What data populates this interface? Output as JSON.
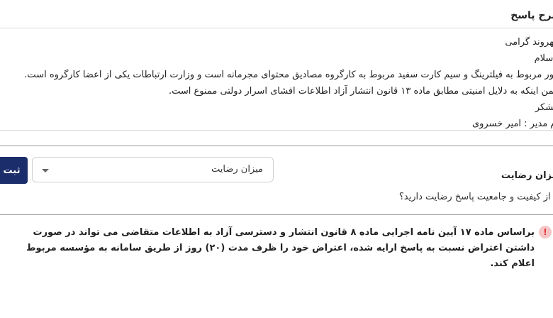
{
  "answer": {
    "header": "شرح پاسخ",
    "lines": [
      "شهروند گرامی",
      "با سلام",
      "امور مربوط به فیلترینگ و سیم کارت سفید مربوط به کارگروه مصادیق محتوای مجرمانه است و وزارت ارتباطات یکی از اعضا کارگروه است.",
      "ضمن اینکه به دلایل امنیتی مطابق ماده ۱۳ قانون انتشار آزاد اطلاعات افشای اسرار دولتی ممنوع است.",
      "باتشکر",
      "نام مدیر : امیر خسروی"
    ]
  },
  "rating": {
    "title": "میزان رضایت",
    "question": "آیا از کیفیت و جامعیت پاسخ رضایت دارید؟",
    "select_value": "میزان رضایت",
    "submit_label": "ثبت"
  },
  "notice": {
    "icon": "exclamation-icon",
    "icon_glyph": "!",
    "text": "براساس ماده ۱۷ آیین نامه اجرایی ماده ۸ قانون انتشار و دسترسی آزاد به اطلاعات متقاضی می تواند در صورت داشتن اعتراض نسبت به پاسخ ارایه شده، اعتراض خود را ظرف مدت (۲۰) روز از طریق سامانه به مؤسسه مربوط اعلام کند."
  }
}
